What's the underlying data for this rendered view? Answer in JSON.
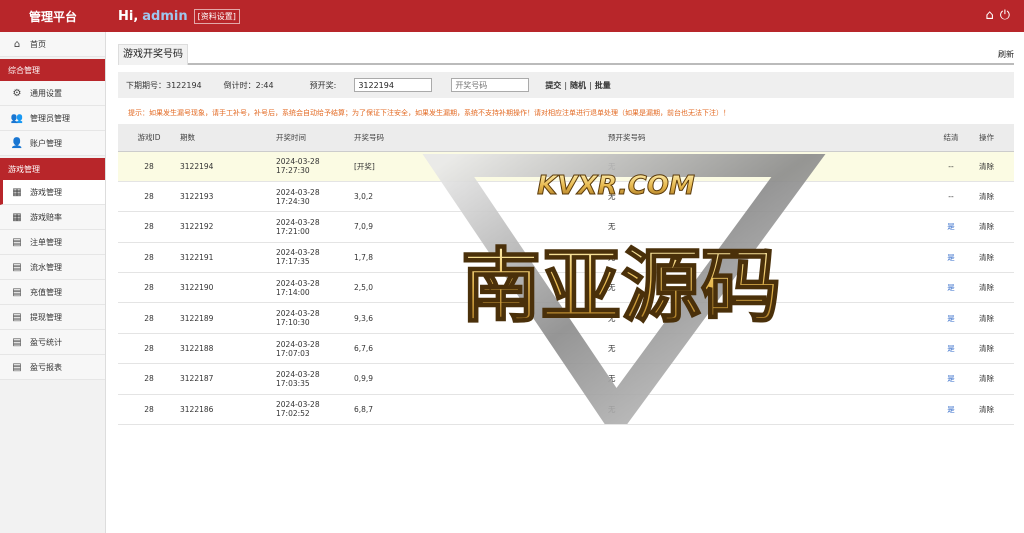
{
  "app": {
    "brand": "管理平台",
    "greeting": "Hi,",
    "user": "admin",
    "profile_link": "[资料设置]"
  },
  "top_icons": [
    "home-icon",
    "power-icon"
  ],
  "sidebar": {
    "home": {
      "label": "首页",
      "icon": "home-icon"
    },
    "group1": {
      "title": "综合管理",
      "items": [
        {
          "label": "通用设置",
          "icon": "gear-icon"
        },
        {
          "label": "管理员管理",
          "icon": "users-icon"
        },
        {
          "label": "账户管理",
          "icon": "user-icon"
        }
      ]
    },
    "group2": {
      "title": "游戏管理",
      "items": [
        {
          "label": "游戏管理",
          "icon": "grid-icon"
        },
        {
          "label": "游戏赔率",
          "icon": "grid-icon"
        },
        {
          "label": "注单管理",
          "icon": "list-icon"
        },
        {
          "label": "流水管理",
          "icon": "list-icon"
        },
        {
          "label": "充值管理",
          "icon": "list-icon"
        },
        {
          "label": "提现管理",
          "icon": "list-icon"
        },
        {
          "label": "盈亏统计",
          "icon": "list-icon"
        },
        {
          "label": "盈亏报表",
          "icon": "list-icon"
        }
      ]
    }
  },
  "page": {
    "title": "游戏开奖号码",
    "refresh": "刷新"
  },
  "filter": {
    "next_period_label": "下期期号：",
    "next_period": "3122194",
    "countdown_label": "倒计时：",
    "countdown": "2:44",
    "preset_label": "预开奖:",
    "preset_value": "3122194",
    "number_placeholder": "开奖号码",
    "submit": "提交",
    "random": "随机",
    "batch": "批量",
    "sep": "|"
  },
  "tip": "提示：如果发生漏号现象，请手工补号，补号后，系统会自动给予结算；为了保证下注安全，如果发生漏期，系统不支持补期操作！请对相应注单进行退单处理（如果是漏期，前台也无法下注）！",
  "table": {
    "headers": [
      "游戏ID",
      "期数",
      "开奖时间",
      "开奖号码",
      "预开奖号码",
      "结清",
      "操作"
    ],
    "rows": [
      {
        "id": "28",
        "period": "3122194",
        "time": "2024-03-28 17:27:30",
        "number": "[开奖]",
        "preset": "无",
        "settled": "--",
        "action": "清除"
      },
      {
        "id": "28",
        "period": "3122193",
        "time": "2024-03-28 17:24:30",
        "number": "3,0,2",
        "preset": "无",
        "settled": "--",
        "action": "清除"
      },
      {
        "id": "28",
        "period": "3122192",
        "time": "2024-03-28 17:21:00",
        "number": "7,0,9",
        "preset": "无",
        "settled": "是",
        "action": "清除"
      },
      {
        "id": "28",
        "period": "3122191",
        "time": "2024-03-28 17:17:35",
        "number": "1,7,8",
        "preset": "无",
        "settled": "是",
        "action": "清除"
      },
      {
        "id": "28",
        "period": "3122190",
        "time": "2024-03-28 17:14:00",
        "number": "2,5,0",
        "preset": "无",
        "settled": "是",
        "action": "清除"
      },
      {
        "id": "28",
        "period": "3122189",
        "time": "2024-03-28 17:10:30",
        "number": "9,3,6",
        "preset": "无",
        "settled": "是",
        "action": "清除"
      },
      {
        "id": "28",
        "period": "3122188",
        "time": "2024-03-28 17:07:03",
        "number": "6,7,6",
        "preset": "无",
        "settled": "是",
        "action": "清除"
      },
      {
        "id": "28",
        "period": "3122187",
        "time": "2024-03-28 17:03:35",
        "number": "0,9,9",
        "preset": "无",
        "settled": "是",
        "action": "清除"
      },
      {
        "id": "28",
        "period": "3122186",
        "time": "2024-03-28 17:02:52",
        "number": "6,8,7",
        "preset": "无",
        "settled": "是",
        "action": "清除"
      }
    ]
  },
  "watermark": {
    "line1": "KVXR.COM",
    "line2": "南亚源码"
  },
  "colors": {
    "primary": "#b8262a",
    "tip": "#e36a23",
    "link": "#2d67c8",
    "highlight_row": "#fbfbe3"
  }
}
